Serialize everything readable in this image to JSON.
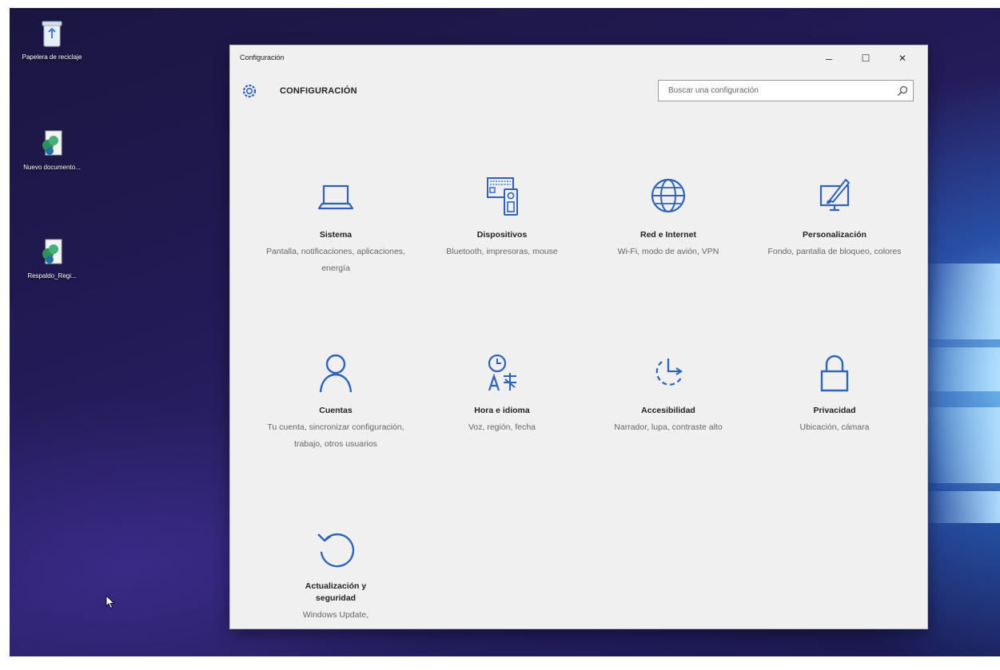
{
  "desktop": {
    "icons": [
      {
        "label": "Papelera de reciclaje"
      },
      {
        "label": "Nuevo documento..."
      },
      {
        "label": "Respaldo_Regi..."
      }
    ]
  },
  "window": {
    "title": "Configuración",
    "minimize_glyph": "–",
    "maximize_glyph": "☐",
    "close_glyph": "✕"
  },
  "header": {
    "icon": "gear-icon",
    "title": "CONFIGURACIÓN"
  },
  "search": {
    "placeholder": "Buscar una configuración",
    "value": "",
    "icon": "search-icon"
  },
  "colors": {
    "accent": "#2f63b8",
    "window_bg": "#f0f0f0",
    "desktop_bg": "#1f1a55"
  },
  "tiles": [
    {
      "title": "Sistema",
      "description": "Pantalla, notificaciones, aplicaciones, energía",
      "icon": "laptop-icon"
    },
    {
      "title": "Dispositivos",
      "description": "Bluetooth, impresoras, mouse",
      "icon": "devices-icon"
    },
    {
      "title": "Red e Internet",
      "description": "Wi-Fi, modo de avión, VPN",
      "icon": "globe-icon"
    },
    {
      "title": "Personalización",
      "description": "Fondo, pantalla de bloqueo, colores",
      "icon": "paint-monitor-icon"
    },
    {
      "title": "Cuentas",
      "description": "Tu cuenta, sincronizar configuración, trabajo, otros usuarios",
      "icon": "person-icon"
    },
    {
      "title": "Hora e idioma",
      "description": "Voz, región, fecha",
      "icon": "time-language-icon"
    },
    {
      "title": "Accesibilidad",
      "description": "Narrador, lupa, contraste alto",
      "icon": "accessibility-icon"
    },
    {
      "title": "Privacidad",
      "description": "Ubicación, cámara",
      "icon": "lock-icon"
    },
    {
      "title": "Actualización y seguridad",
      "description": "Windows Update,",
      "icon": "refresh-icon"
    }
  ]
}
